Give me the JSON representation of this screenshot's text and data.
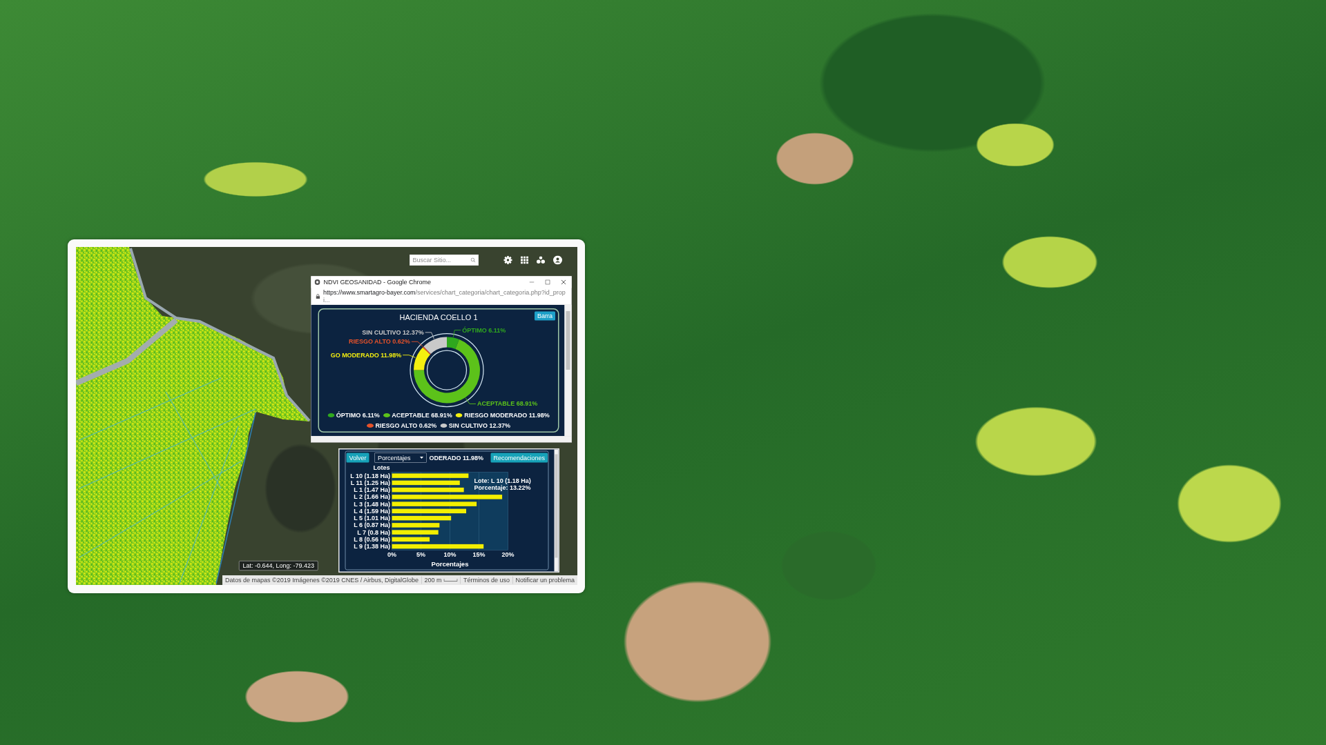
{
  "map_toolbar": {
    "search": {
      "placeholder": "Buscar Sitio..."
    }
  },
  "browser_window": {
    "title": "NDVI GEOSANIDAD - Google Chrome",
    "url_host": "https://www.smartagro-bayer.com",
    "url_path": "/services/chart_categoria/chart_categoria.php?id_propi...",
    "panel": {
      "button": "Barra",
      "chart_data": {
        "type": "donut",
        "title": "HACIENDA COELLO 1",
        "values": [
          6.11,
          68.91,
          11.98,
          0.62,
          12.37
        ],
        "annotations": [
          "ÓPTIMO 6.11%",
          "ACEPTABLE 68.91%",
          "GO MODERADO 11.98%",
          "RIESGO ALTO 0.62%",
          "SIN CULTIVO 12.37%"
        ]
      },
      "legend": [
        {
          "label": "ÓPTIMO 6.11%",
          "color": "#2fa81e"
        },
        {
          "label": "ACEPTABLE 68.91%",
          "color": "#5cc21a"
        },
        {
          "label": "RIESGO MODERADO 11.98%",
          "color": "#f4ef0f"
        },
        {
          "label": "RIESGO ALTO 0.62%",
          "color": "#e6522a"
        },
        {
          "label": "SIN CULTIVO 12.37%",
          "color": "#c9c9c9"
        }
      ]
    }
  },
  "bar_panel": {
    "back_button": "Volver",
    "select": {
      "value": "Porcentajes"
    },
    "caption": "ODERADO 11.98%",
    "button": "Recomendaciones",
    "chart_data": {
      "type": "bar",
      "orientation": "horizontal",
      "xlabel": "Porcentajes",
      "ylabel": "Lotes",
      "categories": [
        "L 10 (1.18 Ha)",
        "L 11 (1.25 Ha)",
        "L 1 (1.47 Ha)",
        "L 2 (1.66 Ha)",
        "L 3 (1.48 Ha)",
        "L 4 (1.59 Ha)",
        "L 5 (1.01 Ha)",
        "L 6 (0.87 Ha)",
        "L 7 (0.8 Ha)",
        "L 8 (0.56 Ha)",
        "L 9 (1.38 Ha)"
      ],
      "values": [
        13.2,
        11.7,
        12.4,
        19.0,
        14.6,
        12.8,
        10.2,
        8.2,
        8.0,
        6.5,
        15.8
      ],
      "xlim": [
        0,
        20
      ],
      "xticks": [
        {
          "value": 0,
          "label": "0%"
        },
        {
          "value": 5,
          "label": "5%"
        },
        {
          "value": 10,
          "label": "10%"
        },
        {
          "value": 15,
          "label": "15%"
        },
        {
          "value": 20,
          "label": "20%"
        }
      ],
      "grid": true
    },
    "tooltip": [
      "Lote: L 10 (1.18 Ha)",
      "Porcentaje: 13.22%"
    ]
  },
  "map_footer": {
    "coordinates": "Lat: -0.644, Long: -79.423",
    "credits": "Datos de mapas ©2019 Imágenes ©2019 CNES / Airbus, DigitalGlobe",
    "scale": "200 m",
    "links": [
      "Términos de uso",
      "Notificar un problema"
    ]
  }
}
